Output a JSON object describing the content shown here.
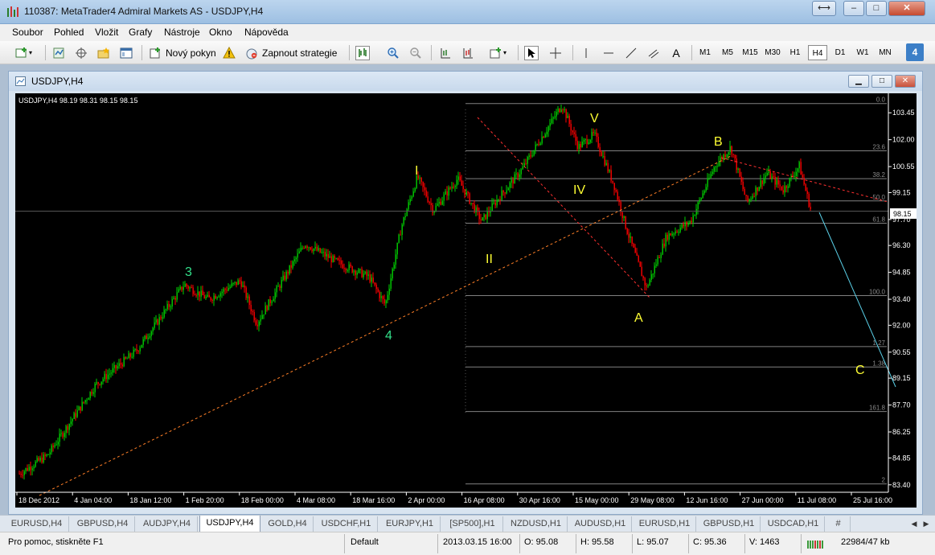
{
  "window": {
    "title": "110387: MetaTrader4 Admiral Markets AS - USDJPY,H4",
    "minimize": "–",
    "maximize": "□",
    "close": "✕",
    "restore_arrow": "⟷"
  },
  "menu": [
    "Soubor",
    "Pohled",
    "Vložit",
    "Grafy",
    "Nástroje",
    "Okno",
    "Nápověda"
  ],
  "toolbar": {
    "new_order": "Nový pokyn",
    "strategy": "Zapnout strategie",
    "timeframes": [
      "M1",
      "M5",
      "M15",
      "M30",
      "H1",
      "H4",
      "D1",
      "W1",
      "MN"
    ],
    "active_timeframe": "H4",
    "text_tool": "A",
    "badge": "4"
  },
  "chart_window": {
    "title": "USDJPY,H4",
    "min": "▁",
    "max": "□",
    "close": "✕"
  },
  "chart": {
    "header": "USDJPY,H4  98.19 98.31 98.15 98.15",
    "current_price": "98.15",
    "price_labels": [
      "103.45",
      "102.00",
      "100.55",
      "99.15",
      "97.70",
      "96.30",
      "94.85",
      "93.40",
      "92.00",
      "90.55",
      "89.15",
      "87.70",
      "86.25",
      "84.85",
      "83.40"
    ],
    "date_labels": [
      "18 Dec 2012",
      "4 Jan 04:00",
      "18 Jan 12:00",
      "1 Feb 20:00",
      "18 Feb 00:00",
      "4 Mar 08:00",
      "18 Mar 16:00",
      "2 Apr 00:00",
      "16 Apr 08:00",
      "30 Apr 16:00",
      "15 May 00:00",
      "29 May 08:00",
      "12 Jun 16:00",
      "27 Jun 00:00",
      "11 Jul 08:00",
      "25 Jul 16:00"
    ],
    "fib_levels": [
      {
        "label": "0.0",
        "price": 103.95
      },
      {
        "label": "23.6",
        "price": 101.4
      },
      {
        "label": "38.2",
        "price": 99.9
      },
      {
        "label": "50.0",
        "price": 98.7
      },
      {
        "label": "61.8",
        "price": 97.5
      },
      {
        "label": "100.0",
        "price": 93.6
      },
      {
        "label": "1.27",
        "price": 90.85
      },
      {
        "label": "1.38",
        "price": 89.75
      },
      {
        "label": "161.8",
        "price": 87.35
      },
      {
        "label": "2",
        "price": 83.45
      }
    ],
    "wave_labels": {
      "w3": "3",
      "w4": "4",
      "wI": "I",
      "wII": "II",
      "wIV": "IV",
      "wV": "V",
      "wA": "A",
      "wB": "B",
      "wC": "C"
    },
    "colors": {
      "bull": "#00d000",
      "bear": "#ff0000",
      "wave_green": "#33e08a",
      "wave_yellow": "#ffff33",
      "trend": "#ff7f27",
      "fib": "#808080",
      "projection": "#5ad0e8"
    },
    "price_scale": {
      "min": 83.0,
      "max": 104.5
    }
  },
  "tabs": [
    "EURUSD,H4",
    "GBPUSD,H4",
    "AUDJPY,H4",
    "USDJPY,H4",
    "GOLD,H4",
    "USDCHF,H1",
    "EURJPY,H1",
    "[SP500],H1",
    "NZDUSD,H1",
    "AUDUSD,H1",
    "EURUSD,H1",
    "GBPUSD,H1",
    "USDCAD,H1",
    "#"
  ],
  "active_tab": "USDJPY,H4",
  "status": {
    "help": "Pro pomoc, stiskněte F1",
    "profile": "Default",
    "datetime": "2013.03.15 16:00",
    "open": "O: 95.08",
    "high": "H: 95.58",
    "low": "L: 95.07",
    "close": "C: 95.36",
    "volume": "V: 1463",
    "traffic": "22984/47 kb"
  }
}
